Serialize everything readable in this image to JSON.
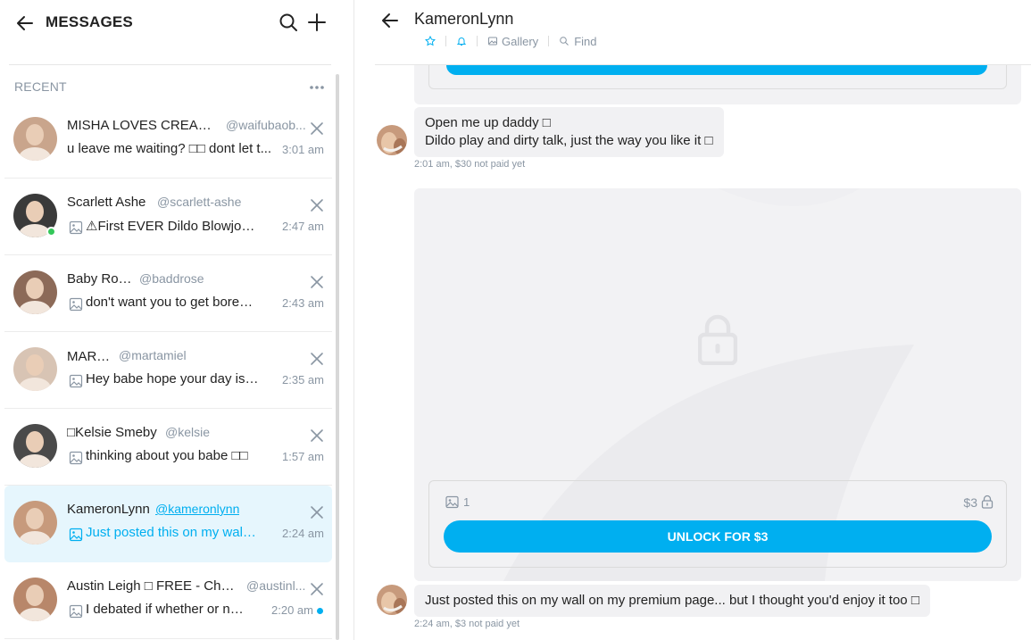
{
  "left_panel": {
    "title": "MESSAGES",
    "recent_label": "RECENT",
    "chats": [
      {
        "name": "MISHA LOVES CREAMP...",
        "handle": "@waifubaob...",
        "preview": "u leave me waiting? □□ dont let t...",
        "time": "3:01 am",
        "has_image": false,
        "online": false,
        "active": false,
        "unread": false,
        "avatar_color": "#c9a58c"
      },
      {
        "name": "Scarlett Ashe",
        "handle": "@scarlett-ashe",
        "preview": "⚠First EVER Dildo Blowjob Vid...",
        "time": "2:47 am",
        "has_image": true,
        "online": true,
        "active": false,
        "unread": false,
        "avatar_color": "#3a3a3a"
      },
      {
        "name": "Baby Rose □",
        "handle": "@baddrose",
        "preview": "don't want you to get bored to...",
        "time": "2:43 am",
        "has_image": true,
        "online": false,
        "active": false,
        "unread": false,
        "avatar_color": "#8c6a58"
      },
      {
        "name": "MARTA ♡",
        "handle": "@martamiel",
        "preview": "Hey babe hope your day is goi...",
        "time": "2:35 am",
        "has_image": true,
        "online": false,
        "active": false,
        "unread": false,
        "avatar_color": "#d8c4b4"
      },
      {
        "name": "□Kelsie Smeby",
        "handle": "@kelsie",
        "preview": "thinking about you babe □□",
        "time": "1:57 am",
        "has_image": true,
        "online": false,
        "active": false,
        "unread": false,
        "avatar_color": "#4a4a4a"
      },
      {
        "name": "KameronLynn",
        "handle": "@kameronlynn",
        "preview": "Just posted this on my wall on...",
        "time": "2:24 am",
        "has_image": true,
        "online": false,
        "active": true,
        "unread": false,
        "avatar_color": "#c79a7c"
      },
      {
        "name": "Austin Leigh □ FREE - Chee...",
        "handle": "@austinl...",
        "preview": "I debated if whether or not I ...",
        "time": "2:20 am",
        "has_image": true,
        "online": false,
        "active": false,
        "unread": true,
        "avatar_color": "#b8876a"
      }
    ]
  },
  "conversation": {
    "title": "KameronLynn",
    "tools": {
      "gallery": "Gallery",
      "find": "Find"
    },
    "messages": [
      {
        "lines": [
          "Open me up daddy □",
          "Dildo play and dirty talk, just the way you like it □"
        ],
        "meta": "2:01 am, $30 not paid yet"
      },
      {
        "lines": [
          "Just posted this on my wall on my premium page... but I thought you'd enjoy it too □"
        ],
        "meta": "2:24 am, $3 not paid yet"
      }
    ],
    "media_card": {
      "media_count": "1",
      "price": "$3",
      "unlock_label": "UNLOCK FOR $3"
    }
  },
  "colors": {
    "accent": "#00aff0",
    "muted": "#8a96a3",
    "bubble": "#f1f1f3",
    "online": "#34c759"
  }
}
